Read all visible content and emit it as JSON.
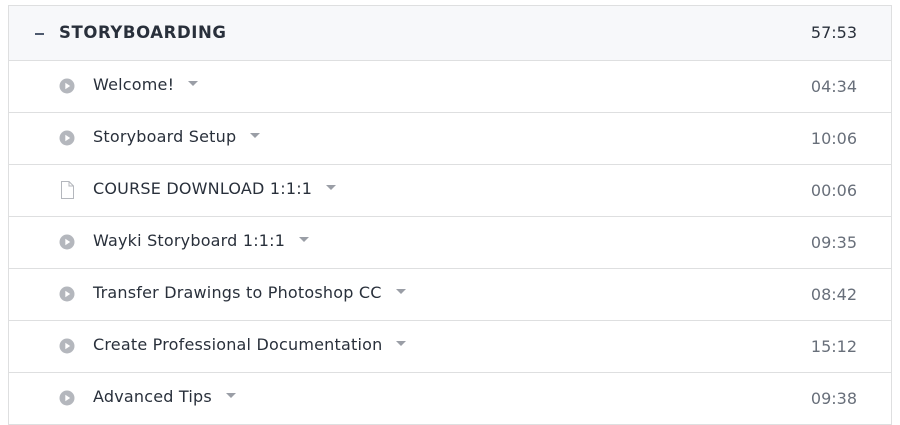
{
  "section": {
    "title": "STORYBOARDING",
    "duration": "57:53",
    "toggle_icon": "minus-icon"
  },
  "lectures": [
    {
      "title": "Welcome!",
      "duration": "04:34",
      "icon": "play-circle-icon"
    },
    {
      "title": "Storyboard Setup",
      "duration": "10:06",
      "icon": "play-circle-icon"
    },
    {
      "title": "COURSE DOWNLOAD 1:1:1",
      "duration": "00:06",
      "icon": "file-icon"
    },
    {
      "title": "Wayki Storyboard 1:1:1",
      "duration": "09:35",
      "icon": "play-circle-icon"
    },
    {
      "title": "Transfer Drawings to Photoshop CC",
      "duration": "08:42",
      "icon": "play-circle-icon"
    },
    {
      "title": "Create Professional Documentation",
      "duration": "15:12",
      "icon": "play-circle-icon"
    },
    {
      "title": "Advanced Tips",
      "duration": "09:38",
      "icon": "play-circle-icon"
    }
  ],
  "colors": {
    "header_bg": "#f7f8fa",
    "border": "#dedfe0",
    "text_primary": "#29303b",
    "text_secondary": "#686f7a",
    "icon_gray": "#b4b7bd"
  }
}
